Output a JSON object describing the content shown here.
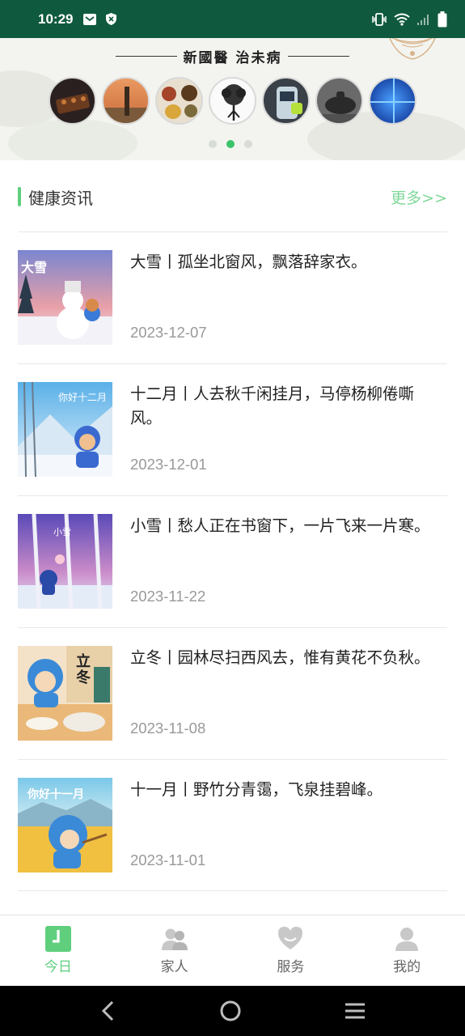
{
  "status_bar": {
    "time": "10:29",
    "icons_left": [
      "mail-icon",
      "shield-icon"
    ],
    "icons_right": [
      "vibrate-icon",
      "wifi-icon",
      "signal-icon",
      "battery-icon"
    ]
  },
  "banner": {
    "title": "新國醫 治未病",
    "circles": [
      "food-tray",
      "dna-figure",
      "spice-bowls",
      "tree-figure",
      "health-device",
      "tea-pot",
      "digital-grid"
    ],
    "dots": 3,
    "active_dot": 1
  },
  "section": {
    "title": "健康资讯",
    "more": "更多>>"
  },
  "news": [
    {
      "title": "大雪丨孤坐北窗风，飘落辞家衣。",
      "date": "2023-12-07",
      "thumb_text": "大雪"
    },
    {
      "title": "十二月丨人去秋千闲挂月，马停杨柳倦嘶风。",
      "date": "2023-12-01",
      "thumb_text": "你好十二月"
    },
    {
      "title": "小雪丨愁人正在书窗下，一片飞来一片寒。",
      "date": "2023-11-22",
      "thumb_text": "小雪"
    },
    {
      "title": "立冬丨园林尽扫西风去，惟有黄花不负秋。",
      "date": "2023-11-08",
      "thumb_text": "立冬"
    },
    {
      "title": "十一月丨野竹分青霭，飞泉挂碧峰。",
      "date": "2023-11-01",
      "thumb_text": "你好十一月"
    }
  ],
  "tabs": [
    {
      "label": "今日",
      "icon": "clock-icon",
      "active": true
    },
    {
      "label": "家人",
      "icon": "family-icon",
      "active": false
    },
    {
      "label": "服务",
      "icon": "service-icon",
      "active": false
    },
    {
      "label": "我的",
      "icon": "profile-icon",
      "active": false
    }
  ],
  "colors": {
    "status_bar": "#0f5a3e",
    "accent": "#5fcf7e",
    "more_link": "#7fd89a"
  }
}
